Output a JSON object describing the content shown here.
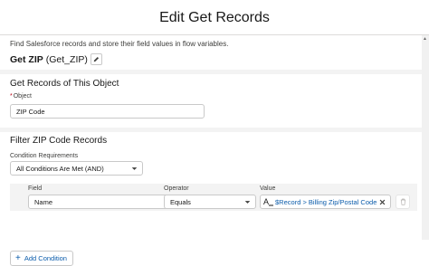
{
  "modal": {
    "title": "Edit Get Records"
  },
  "description": "Find Salesforce records and store their field values in flow variables.",
  "element": {
    "label": "Get ZIP",
    "api_name": "(Get_ZIP)"
  },
  "object_section": {
    "title": "Get Records of This Object",
    "object_label": "Object",
    "required_marker": "*",
    "object_value": "ZIP Code"
  },
  "filter_section": {
    "title": "Filter ZIP Code Records",
    "condition_requirements_label": "Condition Requirements",
    "condition_requirements_value": "All Conditions Are Met (AND)",
    "row": {
      "field_label": "Field",
      "field_value": "Name",
      "operator_label": "Operator",
      "operator_value": "Equals",
      "value_label": "Value",
      "value_value": "$Record > Billing Zip/Postal Code",
      "value_type_glyph": "A"
    },
    "add_condition_label": "Add Condition",
    "add_condition_glyph": "+"
  },
  "icons": {
    "edit": "pencil-icon",
    "dropdown": "chevron-down-icon",
    "text_type": "text-type-icon",
    "remove": "close-icon",
    "delete": "trash-icon",
    "add": "plus-icon"
  },
  "colors": {
    "link": "#0b5cab",
    "required": "#ba0517",
    "border": "#c9c9c9",
    "body_bg": "#f3f3f3"
  }
}
